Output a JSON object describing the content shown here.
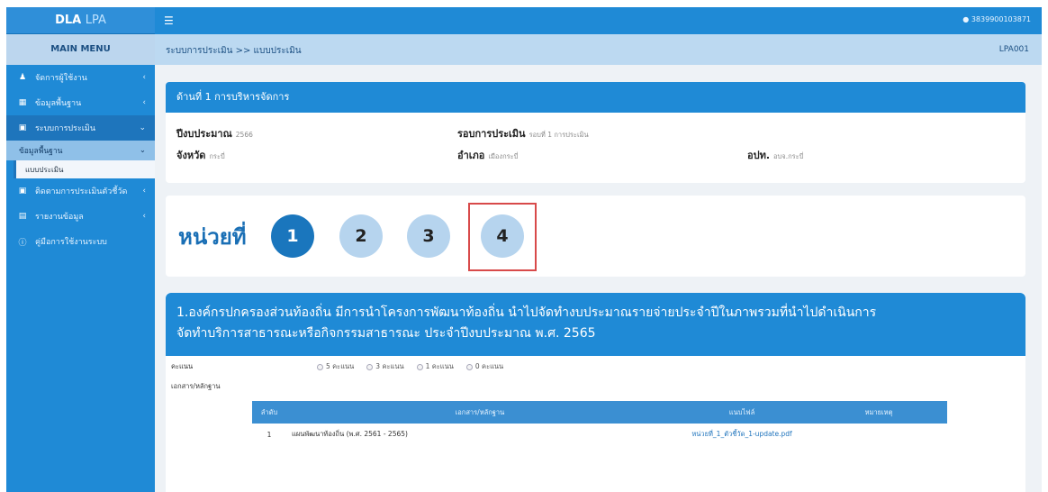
{
  "app": {
    "name_main": "DLA",
    "name_accent": "LPA"
  },
  "sidebar": {
    "main_menu": "MAIN MENU",
    "items": [
      {
        "icon": "user-icon",
        "label": "จัดการผู้ใช้งาน"
      },
      {
        "icon": "database-icon",
        "label": "ข้อมูลพื้นฐาน"
      },
      {
        "icon": "clipboard-icon",
        "label": "ระบบการประเมิน"
      },
      {
        "icon": "clipboard-icon",
        "label": "ติดตามการประเมินตัวชี้วัด"
      },
      {
        "icon": "bar-chart-icon",
        "label": "รายงานข้อมูล"
      },
      {
        "icon": "help-circle-icon",
        "label": "คู่มือการใช้งานระบบ"
      }
    ],
    "sub_item": "ข้อมูลพื้นฐาน",
    "sub_sub_item": "แบบประเมิน"
  },
  "header": {
    "user_id": "3839900103871"
  },
  "breadcrumb": "ระบบการประเมิน >> แบบประเมิน",
  "page_code": "LPA001",
  "section": {
    "title": "ด้านที่ 1 การบริหารจัดการ",
    "fiscal_year_label": "ปีงบประมาณ",
    "fiscal_year_value": "2566",
    "round_label": "รอบการประเมิน",
    "round_value": "รอบที่ 1 การประเมิน",
    "province_label": "จังหวัด",
    "province_value": "กระบี่",
    "district_label": "อำเภอ",
    "district_value": "เมืองกระบี่",
    "org_label": "อปท.",
    "org_value": "อบจ.กระบี่"
  },
  "unit": {
    "label": "หน่วยที่",
    "numbers": [
      "1",
      "2",
      "3",
      "4"
    ],
    "active_index": 0,
    "highlighted_index": 3
  },
  "question": {
    "line1": "1.องค์กรปกครองส่วนท้องถิ่น มีการนำโครงการพัฒนาท้องถิ่น นำไปจัดทำงบประมาณรายจ่ายประจำปีในภาพรวมที่นำไปดำเนินการ",
    "line2": "จัดทำบริการสาธารณะหรือกิจกรรมสาธารณะ ประจำปีงบประมาณ พ.ศ. 2565",
    "score_label": "คะแนน",
    "score_options": [
      "5 คะแนน",
      "3 คะแนน",
      "1 คะแนน",
      "0 คะแนน"
    ],
    "evidence_label": "เอกสาร/หลักฐาน",
    "table_headers": [
      "ลำดับ",
      "เอกสาร/หลักฐาน",
      "แนบไฟล์",
      "หมายเหตุ"
    ],
    "table_rows": [
      [
        "1",
        "แผนพัฒนาท้องถิ่น (พ.ศ. 2561 - 2565)",
        "หน่วยที่_1_ตัวชี้วัด_1-update.pdf",
        ""
      ]
    ]
  },
  "colors": {
    "primary": "#1f8ad6",
    "highlight": "#d84a4a",
    "active_circle": "#1a76bd",
    "inactive_circle": "#b6d4ee"
  }
}
